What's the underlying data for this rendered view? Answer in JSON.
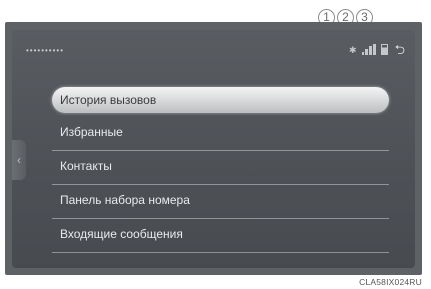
{
  "callouts": [
    "1",
    "2",
    "3"
  ],
  "header": {
    "device_name": "••••••••••",
    "icons": [
      "bluetooth-icon",
      "signal-strength-icon",
      "battery-icon",
      "back-icon"
    ]
  },
  "menu": {
    "items": [
      {
        "label": "История вызовов",
        "selected": true
      },
      {
        "label": "Избранные",
        "selected": false
      },
      {
        "label": "Контакты",
        "selected": false
      },
      {
        "label": "Панель набора номера",
        "selected": false
      },
      {
        "label": "Входящие сообщения",
        "selected": false
      }
    ]
  },
  "side_tab": {
    "glyph": "‹"
  },
  "caption": "CLA58IX024RU",
  "colors": {
    "screen": "#4e5257",
    "selection": "#d9dadb",
    "text": "#e8eaec"
  }
}
